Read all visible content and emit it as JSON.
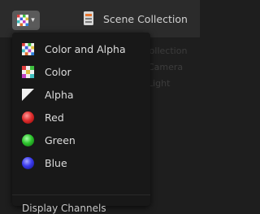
{
  "header": {
    "channel_icon": "color-alpha-checker-icon",
    "caret_icon": "chevron-down-icon",
    "outliner_icon": "scene-collection-icon",
    "title": "Scene Collection"
  },
  "background": {
    "rows": [
      "Collection",
      "Camera",
      "Light"
    ]
  },
  "menu": {
    "items": [
      {
        "label": "Color and Alpha",
        "icon": "color-alpha-checker-icon"
      },
      {
        "label": "Color",
        "icon": "color-checker-icon"
      },
      {
        "label": "Alpha",
        "icon": "alpha-triangle-icon"
      },
      {
        "label": "Red",
        "icon": "red-ball-icon",
        "color": "#e03030"
      },
      {
        "label": "Green",
        "icon": "green-ball-icon",
        "color": "#2ec42e"
      },
      {
        "label": "Blue",
        "icon": "blue-ball-icon",
        "color": "#3a3aee"
      }
    ],
    "title": "Display Channels"
  }
}
